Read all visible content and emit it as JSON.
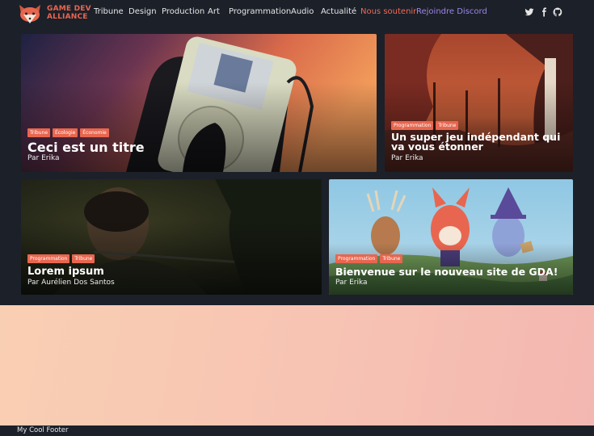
{
  "brand": {
    "line1": "GAME DEV",
    "line2": "ALLIANCE"
  },
  "nav": {
    "items": [
      "Tribune",
      "Design",
      "Production",
      "Art",
      "Programmation",
      "Audio",
      "Actualité"
    ],
    "support": "Nous soutenir",
    "discord": "Rejoindre Discord"
  },
  "social": [
    "twitter-icon",
    "facebook-icon",
    "github-icon"
  ],
  "colors": {
    "accent": "#e8664f",
    "discord": "#9b86e8",
    "background": "#1c2029",
    "tag": "#e8664f"
  },
  "cards": [
    {
      "tags": [
        "Tribune",
        "Écologie",
        "Économie"
      ],
      "title": "Ceci est un titre",
      "author": "Par Erika"
    },
    {
      "tags": [
        "Programmation",
        "Tribune"
      ],
      "title": "Un super jeu indépendant qui va vous étonner",
      "author": "Par Erika"
    },
    {
      "tags": [
        "Programmation",
        "Tribune"
      ],
      "title": "Lorem ipsum",
      "author": "Par Aurélien Dos Santos"
    },
    {
      "tags": [
        "Programmation",
        "Tribune"
      ],
      "title": "Bienvenue sur le nouveau site de GDA!",
      "author": "Par Erika"
    }
  ],
  "footer": {
    "text": "My Cool Footer"
  }
}
